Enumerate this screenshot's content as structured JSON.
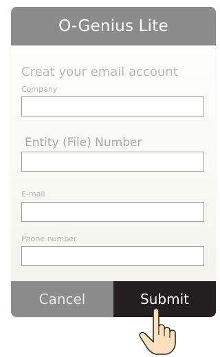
{
  "header": {
    "title": "O-Genius Lite"
  },
  "form": {
    "heading": "Creat your email account",
    "fields": [
      {
        "label": "Company",
        "value": ""
      },
      {
        "label": "Entity (File) Number",
        "value": ""
      },
      {
        "label": "E-mail",
        "value": ""
      },
      {
        "label": "Phone number",
        "value": ""
      }
    ]
  },
  "footer": {
    "cancel_label": "Cancel",
    "submit_label": "Submit"
  },
  "colors": {
    "header_bg": "#8c8c8c",
    "cancel_bg": "#8c8c8c",
    "submit_bg": "#231f20",
    "hand_skin": "#fde0bd"
  },
  "icons": {
    "pointer": "pointing-hand-icon"
  }
}
